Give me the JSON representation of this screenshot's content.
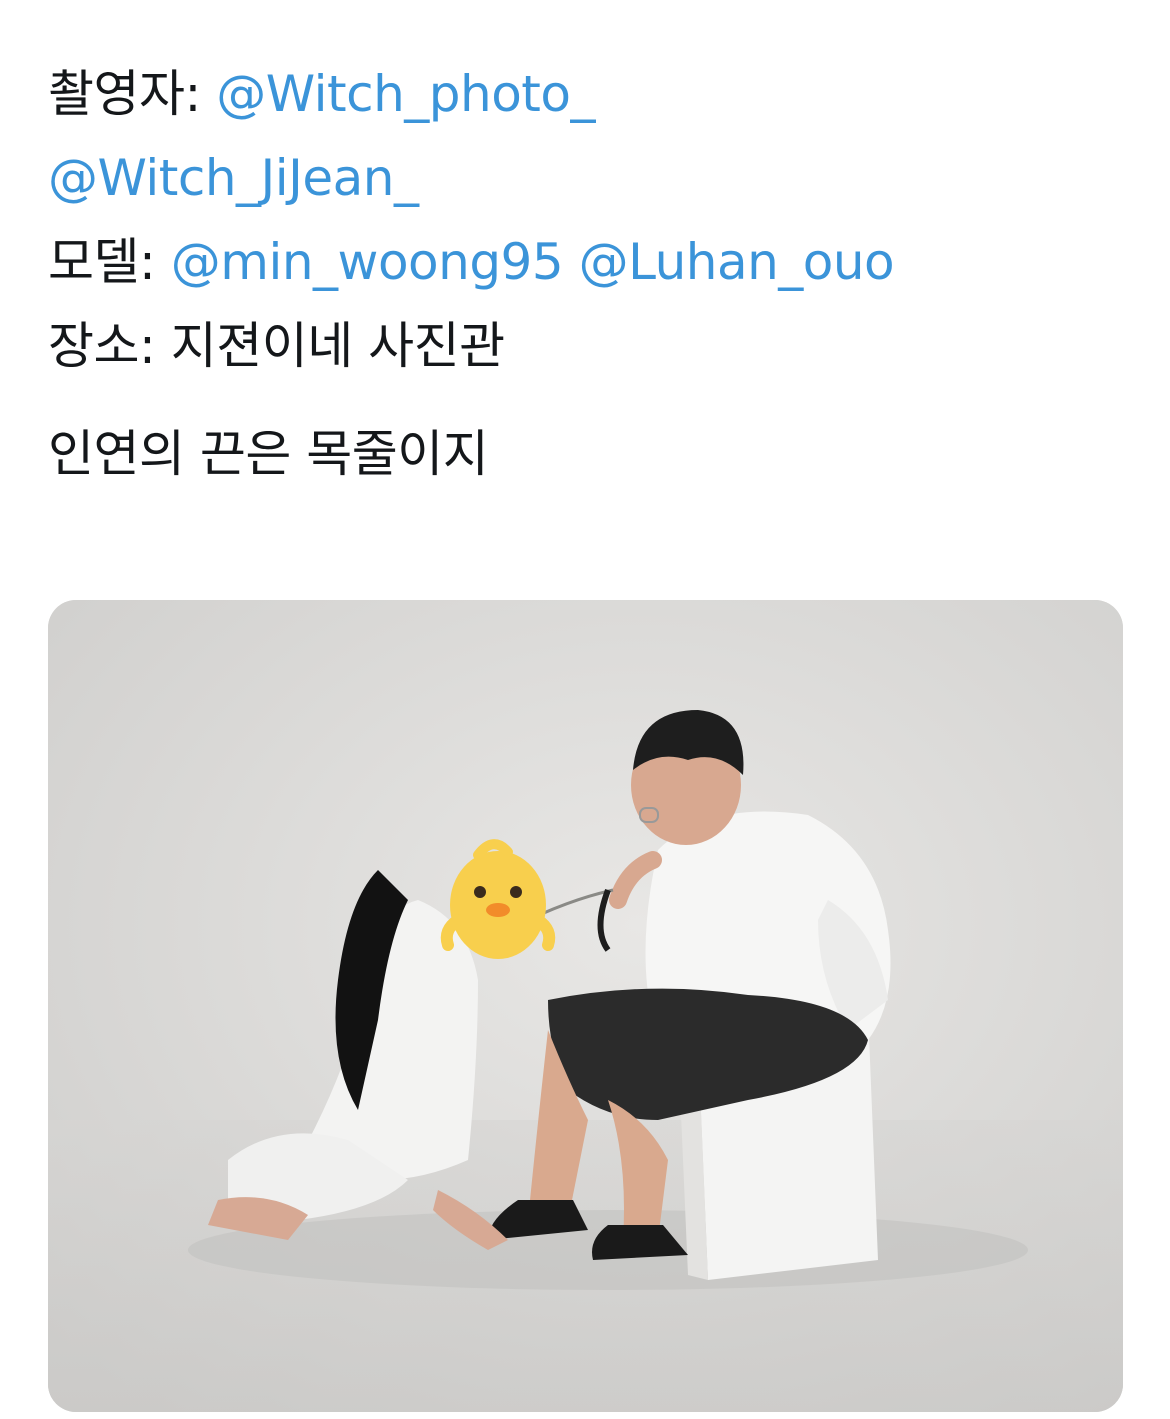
{
  "tweet": {
    "credits": {
      "photographer_label": "촬영자:",
      "photographer_handles": [
        "@Witch_photo_",
        "@Witch_JiJean_"
      ],
      "model_label": "모델:",
      "model_handles": [
        "@min_woong95",
        "@Luhan_ouo"
      ],
      "location_label": "장소:",
      "location_value": "지젼이네 사진관"
    },
    "caption": "인연의 끈은 목줄이지"
  },
  "colors": {
    "text": "#14171a",
    "mention": "#3b94d9",
    "backdrop": "#dcdbd9"
  },
  "media": {
    "scene_icons": [
      "chick-emoji-icon"
    ]
  }
}
